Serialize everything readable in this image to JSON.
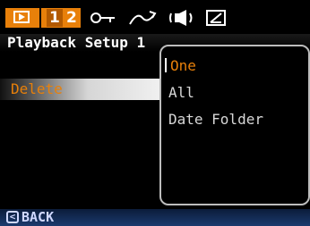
{
  "tabs": {
    "page1": "1",
    "page2": "2",
    "icons": [
      "playback-icon",
      "key-icon",
      "curve-icon",
      "sound-icon",
      "battery-icon"
    ]
  },
  "title": "Playback Setup 1",
  "menu": {
    "selected_item": "Delete"
  },
  "submenu": {
    "options": [
      "One",
      "All",
      "Date Folder"
    ],
    "selected": "One"
  },
  "footer": {
    "back_key": "<",
    "back_label": "BACK"
  },
  "colors": {
    "accent": "#e8800a",
    "panel_border": "#bdbdbd",
    "footer": "#1b3a6e"
  }
}
